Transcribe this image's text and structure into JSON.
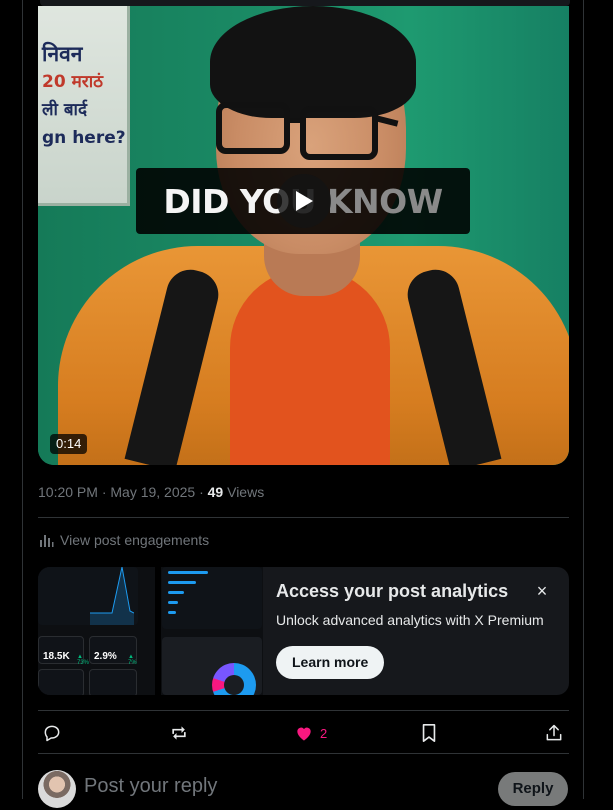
{
  "video": {
    "overlay_word1": "DID YO",
    "overlay_word2": "U KNOW",
    "duration": "0:14",
    "poster_lines": [
      "निवन",
      "20 मराठं",
      "ली बार्द",
      "gn here?"
    ]
  },
  "post": {
    "timestamp": "10:20 PM · May 19, 2025 · ",
    "views_count": "49",
    "views_label": " Views",
    "engagements_label": "View post engagements"
  },
  "promo": {
    "title": "Access your post analytics",
    "subtitle": "Unlock advanced analytics with X Premium",
    "cta": "Learn more",
    "close_glyph": "×",
    "tiles": [
      {
        "value": "18.5K",
        "growth": "▲ 73%"
      },
      {
        "value": "2.9%",
        "growth": "▲ 7%"
      }
    ]
  },
  "actions": {
    "like_count": "2"
  },
  "reply": {
    "placeholder": "Post your reply",
    "button": "Reply"
  },
  "colors": {
    "accent": "#1d9bf0",
    "like": "#f91880",
    "background": "#000000"
  }
}
